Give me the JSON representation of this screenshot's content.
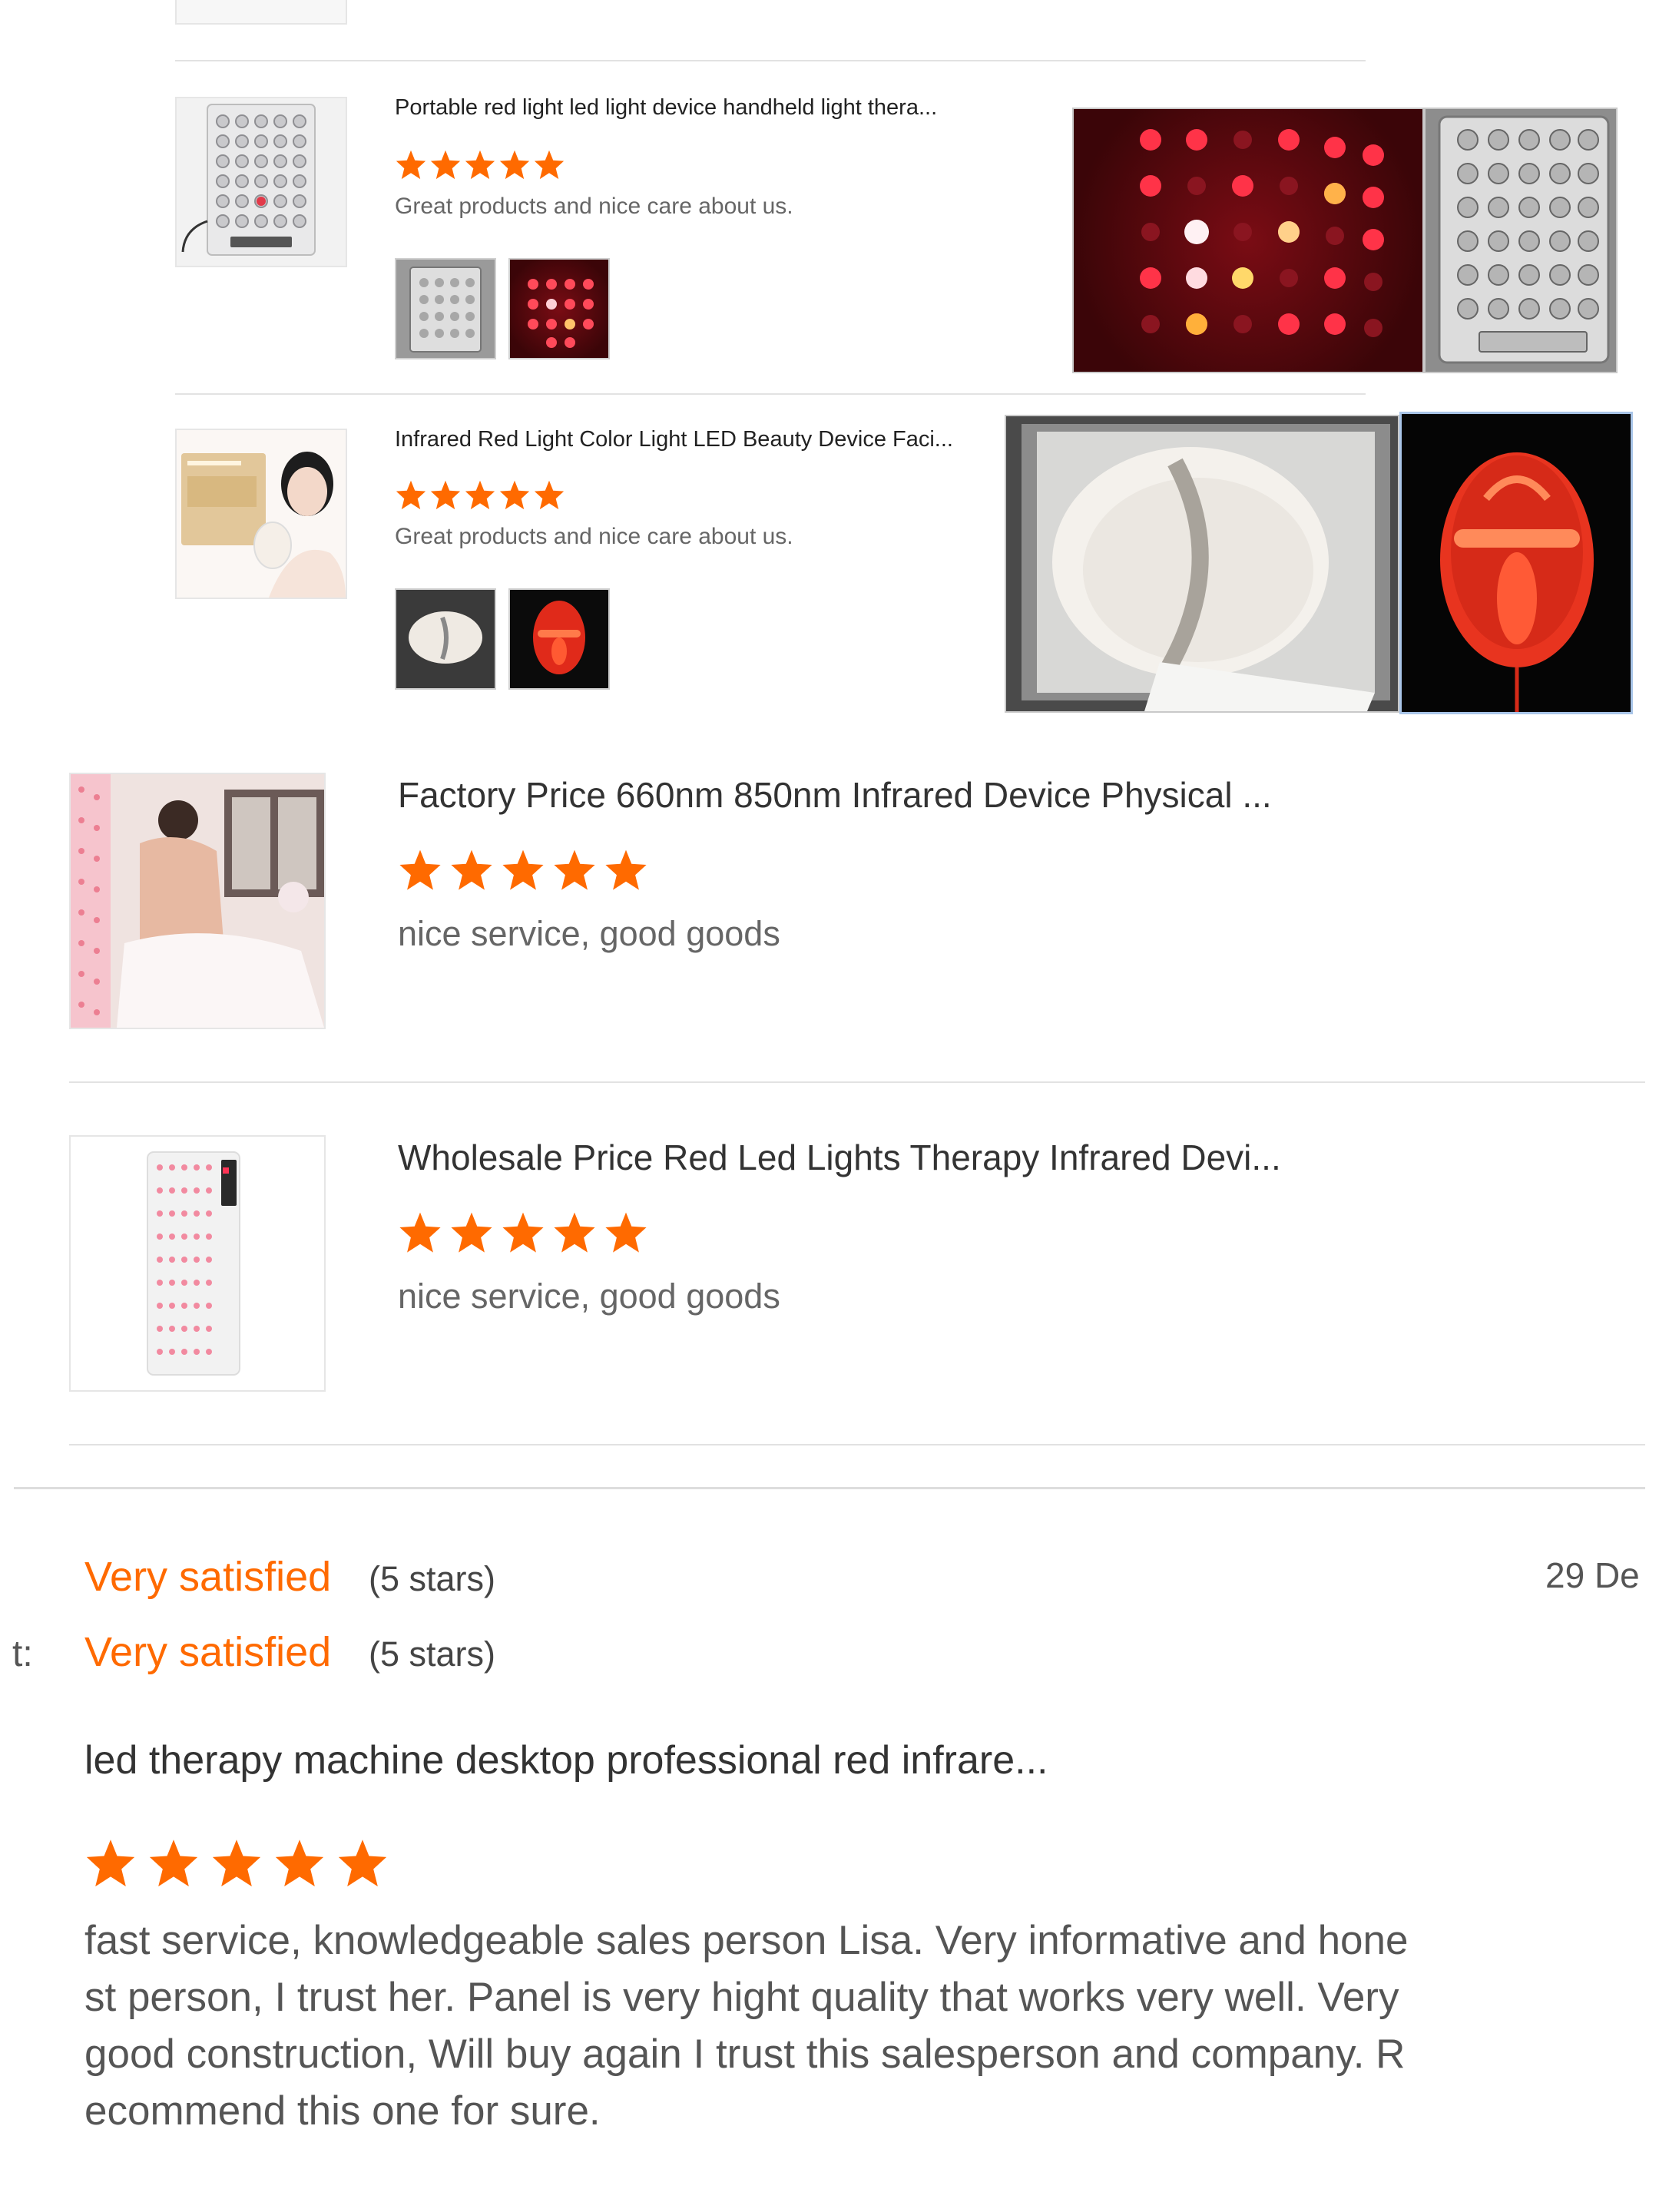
{
  "small_reviews": [
    {
      "title": "Portable red light led light device handheld light thera...",
      "comment": "Great products and nice care about us.",
      "rating": 5
    },
    {
      "title": "Infrared Red Light Color Light LED Beauty Device Faci...",
      "comment": "Great products and nice care about us.",
      "rating": 5
    }
  ],
  "large_reviews": [
    {
      "title": "Factory Price 660nm 850nm Infrared Device Physical ...",
      "comment": "nice service, good goods",
      "rating": 5
    },
    {
      "title": "Wholesale Price Red Led Lights Therapy Infrared Devi...",
      "comment": "nice service, good goods",
      "rating": 5
    }
  ],
  "feedback": {
    "rating_1_label": "Very satisfied",
    "rating_1_stars": "(5 stars)",
    "date": "29 De",
    "prefix": "t:",
    "rating_2_label": "Very satisfied",
    "rating_2_stars": "(5 stars)",
    "product_title": "led therapy machine desktop professional red infrare...",
    "rating": 5,
    "review_lines": [
      "fast service, knowledgeable sales person Lisa. Very informative and hone",
      "st person, I trust her. Panel is very hight quality that works very well. Very",
      "good construction, Will buy again I trust this salesperson and company. R",
      "ecommend this one for sure."
    ]
  },
  "colors": {
    "star": "#ff6a00",
    "satisfied_text": "#ff6a00",
    "divider": "#e2e2e2"
  }
}
